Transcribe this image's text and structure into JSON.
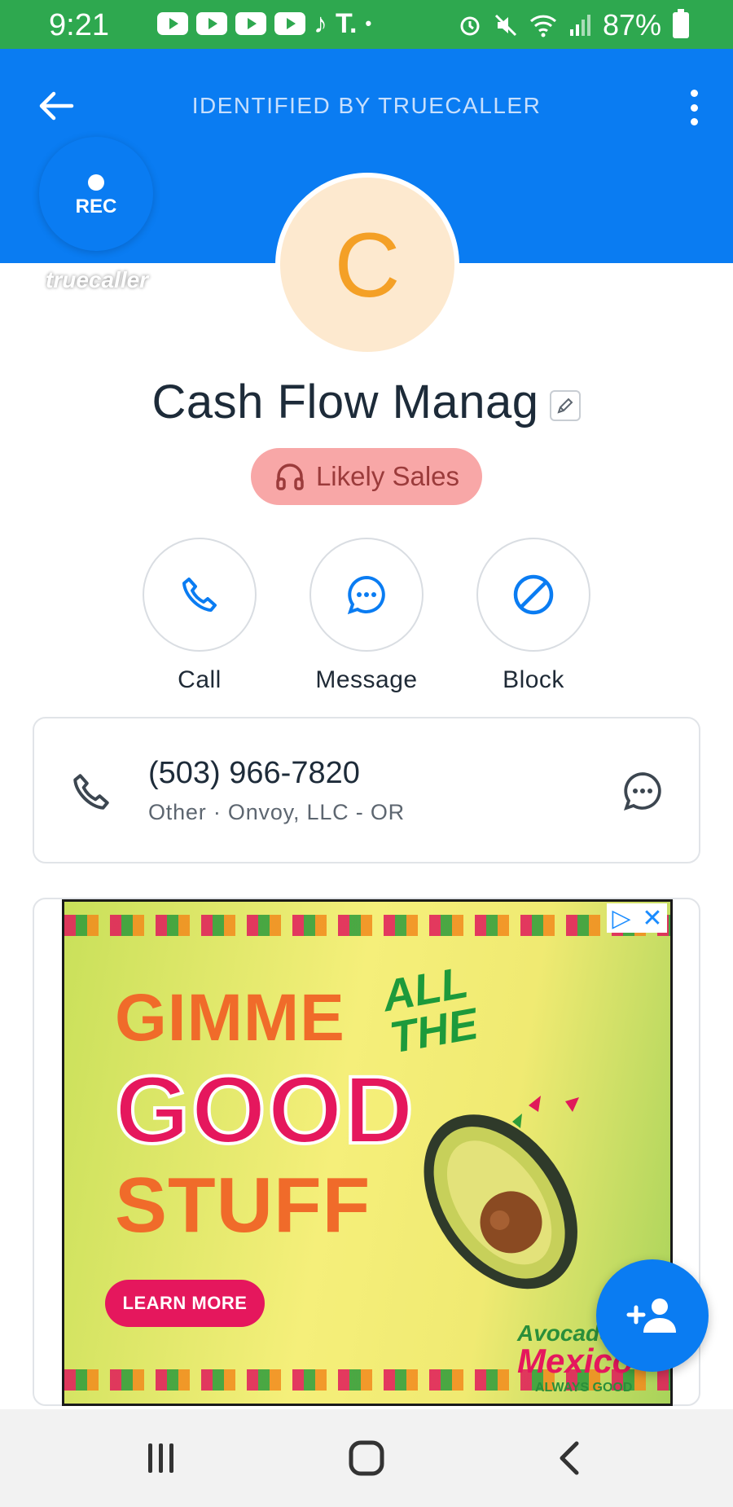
{
  "status_bar": {
    "time": "9:21",
    "battery": "87%",
    "notification_icons": [
      "youtube-icon",
      "youtube-icon",
      "youtube-icon",
      "youtube-icon",
      "tiktok-icon",
      "t-mobile-icon",
      "dot-icon"
    ],
    "system_icons": [
      "alarm-icon",
      "mute-icon",
      "wifi-icon",
      "signal-icon",
      "battery-icon"
    ]
  },
  "header": {
    "title": "IDENTIFIED BY TRUECALLER",
    "color": "#0a7cf2"
  },
  "rec_button": {
    "label": "REC"
  },
  "watermark": "truecaller",
  "contact": {
    "avatar_letter": "C",
    "name": "Cash Flow Manag",
    "tag": "Likely Sales"
  },
  "actions": [
    {
      "label": "Call",
      "icon": "phone-icon"
    },
    {
      "label": "Message",
      "icon": "message-icon"
    },
    {
      "label": "Block",
      "icon": "block-icon"
    }
  ],
  "phone": {
    "number": "(503) 966-7820",
    "meta": "Other · Onvoy, LLC - OR"
  },
  "ad": {
    "line1": "GIMME",
    "line1b": "ALL THE",
    "line2": "GOOD",
    "line3": "STUFF",
    "cta": "LEARN MORE",
    "brand_top": "Avocados",
    "brand_main": "Mexico",
    "brand_tagline": "ALWAYS GOOD"
  },
  "colors": {
    "accent": "#0a7cf2",
    "status_bar": "#2ea84f",
    "tag_bg": "#f8a7a7",
    "avatar_bg": "#fde9cf",
    "avatar_letter": "#f4a026"
  }
}
